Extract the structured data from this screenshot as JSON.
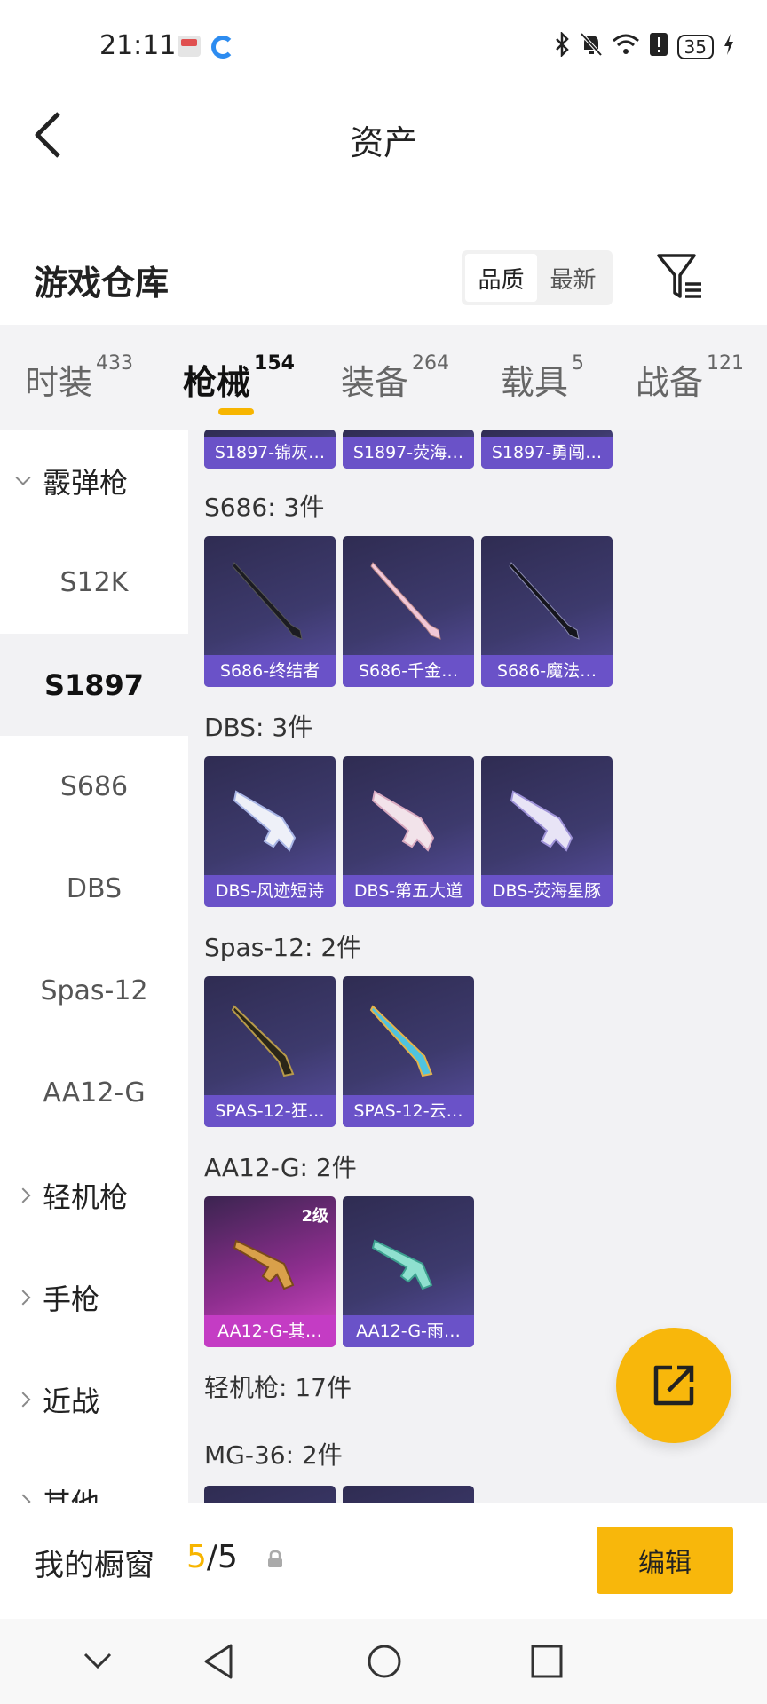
{
  "status_bar": {
    "time": "21:11",
    "battery": "35"
  },
  "header": {
    "title": "资产"
  },
  "warehouse": {
    "title": "游戏仓库",
    "sort_quality": "品质",
    "sort_newest": "最新"
  },
  "tabs": [
    {
      "label": "时装",
      "count": "433"
    },
    {
      "label": "枪械",
      "count": "154"
    },
    {
      "label": "装备",
      "count": "264"
    },
    {
      "label": "载具",
      "count": "5"
    },
    {
      "label": "战备",
      "count": "121"
    }
  ],
  "sidenav": [
    {
      "label": "霰弹枪"
    },
    {
      "label": "S12K"
    },
    {
      "label": "S1897"
    },
    {
      "label": "S686"
    },
    {
      "label": "DBS"
    },
    {
      "label": "Spas-12"
    },
    {
      "label": "AA12-G"
    },
    {
      "label": "轻机枪"
    },
    {
      "label": "手枪"
    },
    {
      "label": "近战"
    },
    {
      "label": "其他"
    }
  ],
  "content": {
    "s1897_items": [
      "S1897-锦灰…",
      "S1897-荧海…",
      "S1897-勇闯…"
    ],
    "s686": {
      "header": "S686: 3件",
      "items": [
        "S686-终结者",
        "S686-千金…",
        "S686-魔法…"
      ]
    },
    "dbs": {
      "header": "DBS: 3件",
      "items": [
        "DBS-风迹短诗",
        "DBS-第五大道",
        "DBS-荧海星豚"
      ]
    },
    "spas": {
      "header": "Spas-12: 2件",
      "items": [
        "SPAS-12-狂…",
        "SPAS-12-云…"
      ]
    },
    "aa12": {
      "header": "AA12-G: 2件",
      "level": "2级",
      "items": [
        "AA12-G-其…",
        "AA12-G-雨…"
      ]
    },
    "lmg_header": "轻机枪: 17件",
    "mg36_header": "MG-36: 2件"
  },
  "showcase": {
    "label": "我的橱窗",
    "count_used": "5",
    "count_total": "/5",
    "edit_label": "编辑"
  },
  "colors": {
    "accent": "#f8b70b",
    "card_bar": "#6a52c8",
    "card_bar_epic": "#c43cc4"
  }
}
